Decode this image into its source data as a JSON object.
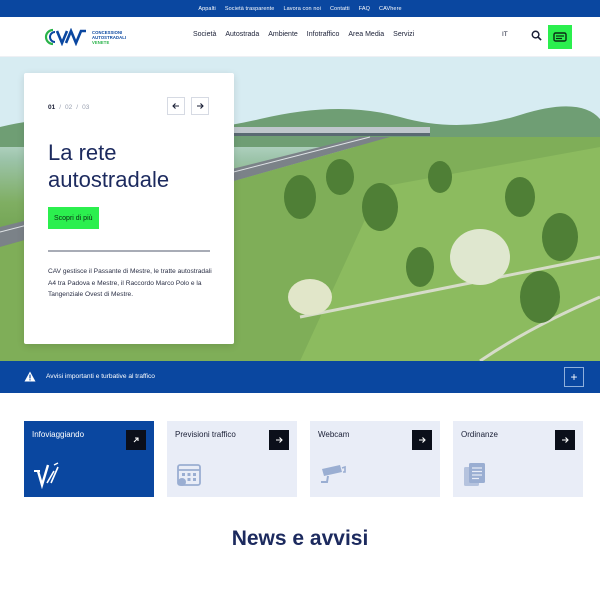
{
  "topbar": {
    "links": [
      "Appalti",
      "Società trasparente",
      "Lavora con noi",
      "Contatti",
      "FAQ",
      "CAVhere"
    ]
  },
  "header": {
    "logo": {
      "line1": "CONCESSIONI",
      "line2": "AUTOSTRADALI",
      "line3": "VENETE"
    },
    "nav": [
      "Società",
      "Autostrada",
      "Ambiente",
      "Infotraffico",
      "Area Media",
      "Servizi"
    ],
    "lang": "IT",
    "icons": {
      "search": "search-icon",
      "camera": "camera-icon"
    }
  },
  "hero": {
    "pager": {
      "current": "01",
      "items": [
        "02",
        "03"
      ],
      "separator": "/"
    },
    "title": "La rete autostradale",
    "cta": "Scopri di più",
    "description": "CAV gestisce il Passante di Mestre, le tratte autostradali A4 tra Padova e Mestre, il Raccordo Marco Polo e la Tangenziale Ovest di Mestre."
  },
  "alert": {
    "text": "Avvisi importanti e turbative al traffico",
    "expand": "+"
  },
  "tiles": [
    {
      "label": "Infoviaggiando",
      "icon": "infoviaggiando-logo-icon",
      "active": true
    },
    {
      "label": "Previsioni traffico",
      "icon": "calendar-icon",
      "active": false
    },
    {
      "label": "Webcam",
      "icon": "cctv-camera-icon",
      "active": false
    },
    {
      "label": "Ordinanze",
      "icon": "documents-icon",
      "active": false
    }
  ],
  "news": {
    "title": "News e avvisi"
  },
  "colors": {
    "primary": "#0a47a0",
    "accent": "#2bef4e",
    "tile_bg": "#e9edf7",
    "title": "#1c2a5e"
  }
}
